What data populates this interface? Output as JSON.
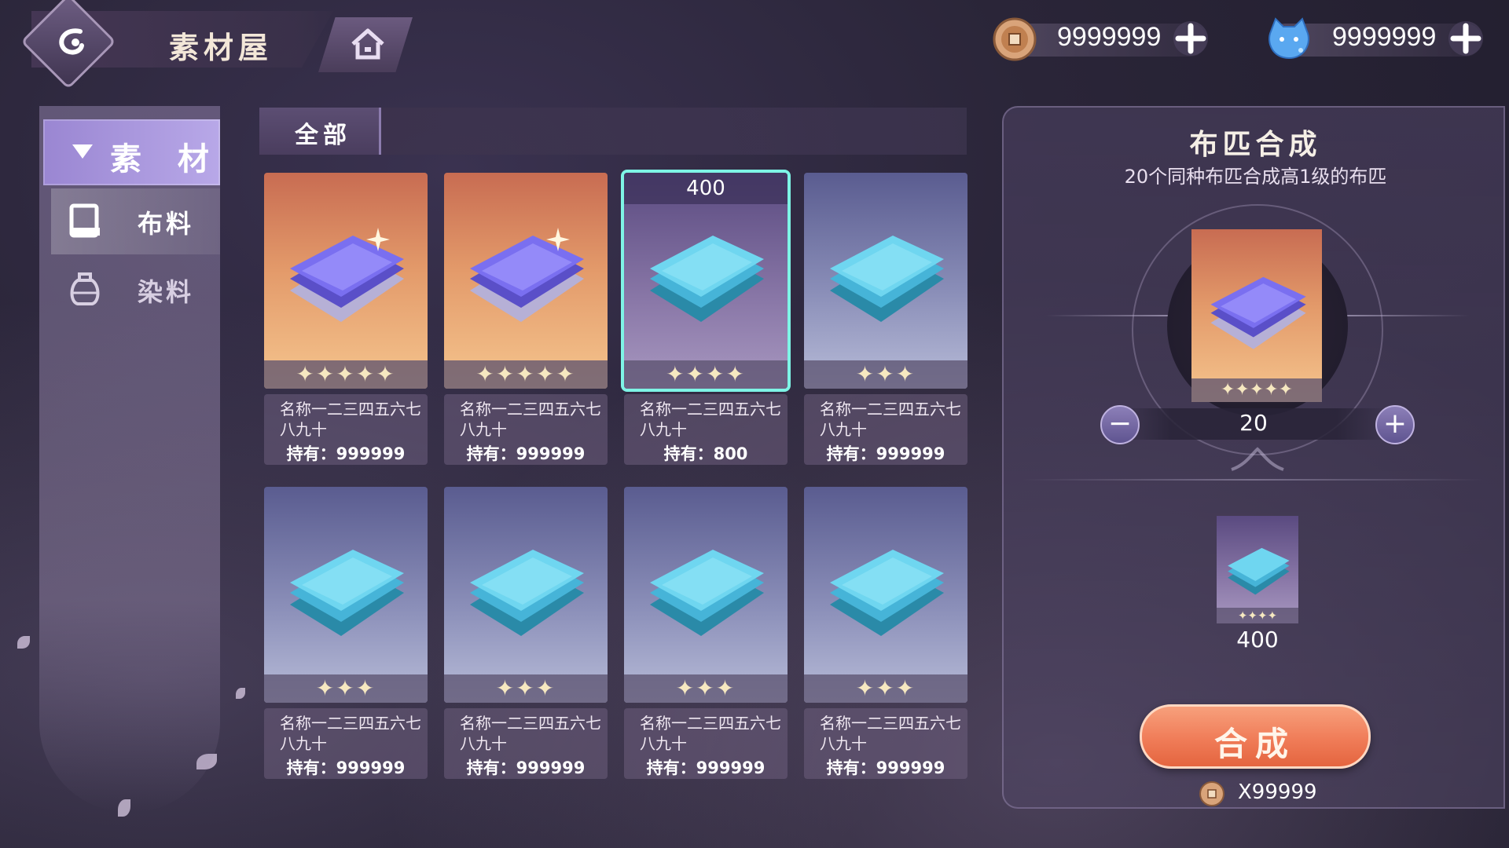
{
  "header": {
    "title": "素材屋",
    "back_icon": "back-swirl-icon",
    "home_icon": "home-icon"
  },
  "currencies": [
    {
      "icon": "copper-coin-icon",
      "value": "9999999"
    },
    {
      "icon": "blue-cat-gem-icon",
      "value": "9999999"
    }
  ],
  "sidebar": {
    "category": "素 材",
    "items": [
      {
        "label": "布料",
        "icon": "book-icon",
        "active": true
      },
      {
        "label": "染料",
        "icon": "dye-jar-icon",
        "active": false
      }
    ]
  },
  "filter": {
    "tab_label": "全部"
  },
  "items": [
    {
      "name": "名称一二三四五六七八九十",
      "owned": "持有：999999",
      "stars": "✦✦✦✦✦",
      "rarity": 5,
      "selected": false,
      "top_count": ""
    },
    {
      "name": "名称一二三四五六七八九十",
      "owned": "持有：999999",
      "stars": "✦✦✦✦✦",
      "rarity": 5,
      "selected": false,
      "top_count": ""
    },
    {
      "name": "名称一二三四五六七八九十",
      "owned": "持有：800",
      "stars": "✦✦✦✦",
      "rarity": 4,
      "selected": true,
      "top_count": "400"
    },
    {
      "name": "名称一二三四五六七八九十",
      "owned": "持有：999999",
      "stars": "✦✦✦",
      "rarity": 3,
      "selected": false,
      "top_count": ""
    },
    {
      "name": "名称一二三四五六七八九十",
      "owned": "持有：999999",
      "stars": "✦✦✦",
      "rarity": 3,
      "selected": false,
      "top_count": ""
    },
    {
      "name": "名称一二三四五六七八九十",
      "owned": "持有：999999",
      "stars": "✦✦✦",
      "rarity": 3,
      "selected": false,
      "top_count": ""
    },
    {
      "name": "名称一二三四五六七八九十",
      "owned": "持有：999999",
      "stars": "✦✦✦",
      "rarity": 3,
      "selected": false,
      "top_count": ""
    },
    {
      "name": "名称一二三四五六七八九十",
      "owned": "持有：999999",
      "stars": "✦✦✦",
      "rarity": 3,
      "selected": false,
      "top_count": ""
    }
  ],
  "craft_panel": {
    "title": "布匹合成",
    "subtitle": "20个同种布匹合成高1级的布匹",
    "source_stars": "✦✦✦✦✦",
    "quantity": "20",
    "minus_label": "−",
    "plus_label": "+",
    "result_stars": "✦✦✦✦",
    "result_count": "400",
    "button_label": "合成",
    "cost": "X99999"
  },
  "colors": {
    "accent_selected": "#7ef4e6",
    "craft_button": "#f07c58",
    "sidebar_active": "#9a86d2"
  }
}
